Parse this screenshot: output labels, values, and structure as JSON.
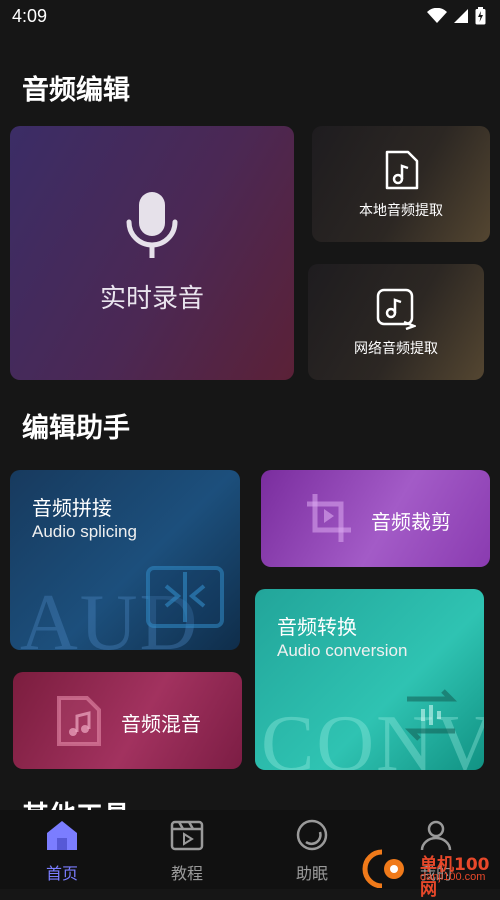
{
  "status": {
    "time": "4:09"
  },
  "sections": {
    "audio_edit": "音频编辑",
    "edit_helper": "编辑助手",
    "other_tools": "其他工具"
  },
  "cards": {
    "realtime_record": "实时录音",
    "local_extract": "本地音频提取",
    "network_extract": "网络音频提取",
    "splice_title": "音频拼接",
    "splice_sub": "Audio splicing",
    "splice_bg": "AUD",
    "crop_title": "音频裁剪",
    "convert_title": "音频转换",
    "convert_sub": "Audio conversion",
    "convert_bg": "CONV",
    "mix_title": "音频混音"
  },
  "tabs": [
    {
      "label": "首页",
      "icon": "home-icon",
      "active": true
    },
    {
      "label": "教程",
      "icon": "video-tutorial-icon",
      "active": false
    },
    {
      "label": "助眠",
      "icon": "moon-icon",
      "active": false
    },
    {
      "label": "我的",
      "icon": "user-icon",
      "active": false
    }
  ],
  "watermark": {
    "line1": "单机100网",
    "line2": "danji100.com"
  },
  "colors": {
    "active_tab": "#7b7dff",
    "inactive_tab": "#9a9a9a"
  }
}
